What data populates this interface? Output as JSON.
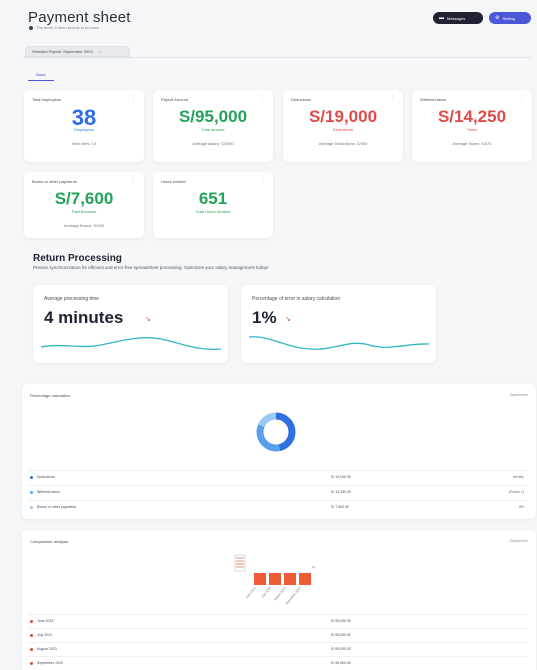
{
  "header": {
    "title": "Payment sheet",
    "subtitle": "The block 3 new records in process",
    "messages_label": "Messages",
    "setting_label": "Setting",
    "messages_icon": "chat-icon",
    "setting_icon": "gear-icon"
  },
  "tab": {
    "label": "Selected Payroll: September 2023",
    "close": "×"
  },
  "subtab": {
    "label": "Basic"
  },
  "stats": [
    {
      "label": "Total employees",
      "value": "38",
      "unit": "Employees",
      "foot": "New hires: 14",
      "color": "#2f6fe0"
    },
    {
      "label": "Payroll Amount",
      "value": "S/95,000",
      "unit": "Total amount",
      "foot": "Average salary: S/2500",
      "color": "#22a35a"
    },
    {
      "label": "Deductions",
      "value": "S/19,000",
      "unit": "Deductions",
      "foot": "Average Deductions: S/500",
      "color": "#e04a4a"
    },
    {
      "label": "Withheld taxes",
      "value": "S/14,250",
      "unit": "Taxes",
      "foot": "Average Taxes: S/375",
      "color": "#e04a4a"
    },
    {
      "label": "Bonus or other payments",
      "value": "S/7,600",
      "unit": "Paid Bonuses",
      "foot": "Average Bonus: S/200",
      "color": "#22a35a"
    },
    {
      "label": "Hours worked",
      "value": "651",
      "unit": "Total Hours Worked",
      "foot": "",
      "color": "#22a35a"
    }
  ],
  "return_processing": {
    "title": "Return Processing",
    "subtitle": "Precise synchronization for efficient and error-free spreadsheet processing. Optimizes your salary management today!",
    "metrics": [
      {
        "label": "Average processing time",
        "value": "4 minutes",
        "trend": "↘"
      },
      {
        "label": "Percentage of error in salary calculation",
        "value": "1%",
        "trend": "↘"
      }
    ]
  },
  "percentage_panel": {
    "title": "Percentage calculation",
    "right_label": "Septiembre",
    "rows": [
      {
        "name": "Deductions",
        "amount": "S/ 19,000.00",
        "pct": "Identify",
        "color": "#2f6fe0"
      },
      {
        "name": "Withheld taxes",
        "amount": "S/ 14,250.00",
        "pct": "(Phase 1)",
        "color": "#5aa0e8"
      },
      {
        "name": "Bonus or other payments",
        "amount": "S/ 7,600.00",
        "pct": "8%",
        "color": "#9cc8f0"
      }
    ],
    "donut": [
      {
        "value": 19000,
        "color": "#2f6fe0"
      },
      {
        "value": 14250,
        "color": "#5aa0e8"
      },
      {
        "value": 7600,
        "color": "#9cc8f0"
      }
    ]
  },
  "comparative_panel": {
    "title": "Comparative analysis",
    "right_label": "Septiembre",
    "chart_data": {
      "type": "bar",
      "categories": [
        "June 2023",
        "July 2023",
        "August 2023",
        "September 2023"
      ],
      "series": [
        {
          "values": [
            95000,
            95000,
            95000,
            95000
          ]
        }
      ],
      "top_label": "12"
    },
    "rows": [
      {
        "name": "June 2023",
        "amount": "S/ 95,000.00",
        "color": "#e04a2f"
      },
      {
        "name": "July 2023",
        "amount": "S/ 95,000.00",
        "color": "#e04a2f"
      },
      {
        "name": "August 2023",
        "amount": "S/ 95,000.00",
        "color": "#e04a2f"
      },
      {
        "name": "September 2023",
        "amount": "S/ 95,000.00",
        "color": "#e04a2f"
      }
    ]
  }
}
